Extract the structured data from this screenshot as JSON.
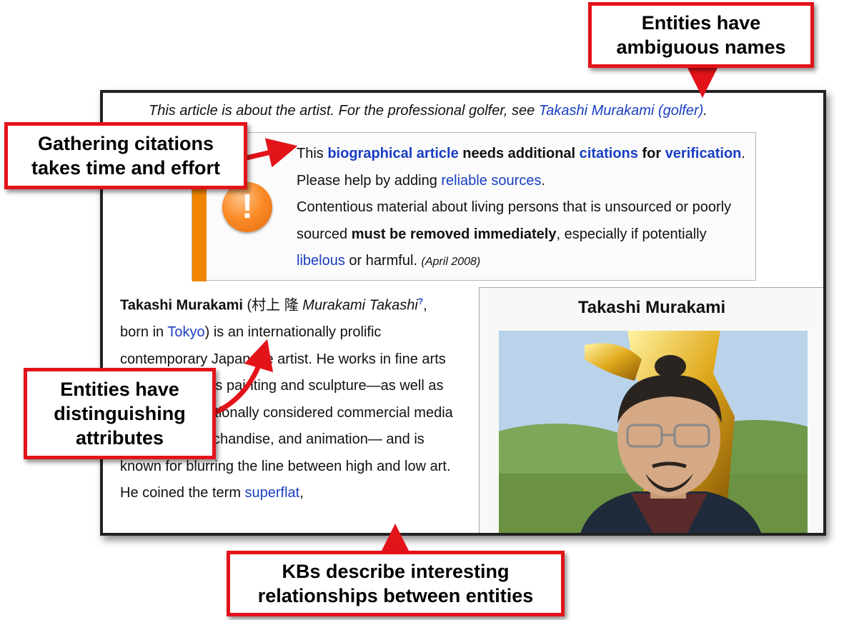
{
  "hatnote": {
    "prefix": "This article is about the artist. For the professional golfer, see ",
    "link": "Takashi Murakami (golfer)",
    "suffix": "."
  },
  "ambox": {
    "t1": "This ",
    "l1": "biographical article",
    "t2": " needs additional ",
    "l2": "citations",
    "t3": " for ",
    "l3": "verification",
    "t4": ". Please help by adding ",
    "l4": "reliable sources",
    "t5": ".",
    "t6": "Contentious material about living persons that is unsourced or poorly sourced ",
    "b1": "must be removed immediately",
    "t7": ", especially if potentially ",
    "l5": "libelous",
    "t8": " or harmful. ",
    "date": "(April 2008)"
  },
  "article": {
    "name": "Takashi Murakami",
    "kanji": " (村上 隆 ",
    "romaji": "Murakami Takashi",
    "sup": "?",
    "t1": ", born in ",
    "city": "Tokyo",
    "t2": ") is an internationally prolific contemporary Japanese artist. He works in fine arts media—such as painting and sculpture—as well as what is conventionally considered commercial media—fashion, merchandise, and animation— and is known for blurring the line between high and low art. He coined the term ",
    "term": "superflat",
    "t3": ","
  },
  "infobox": {
    "title": "Takashi Murakami"
  },
  "callouts": {
    "ambiguous_names": "Entities have ambiguous names",
    "citations": "Gathering citations takes time and effort",
    "attributes": "Entities have distinguishing attributes",
    "relationships": "KBs describe interesting relationships between entities"
  },
  "colors": {
    "callout_border": "#e3131a",
    "link": "#1a3ec2",
    "ambox_bar": "#f28500"
  }
}
